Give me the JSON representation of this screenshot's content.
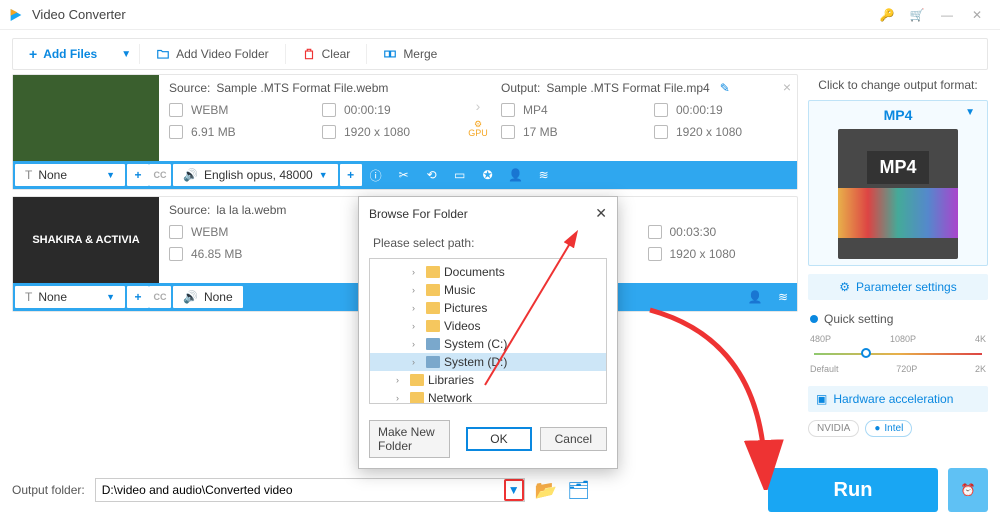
{
  "app": {
    "title": "Video Converter"
  },
  "toolbar": {
    "add_files": "Add Files",
    "add_folder": "Add Video Folder",
    "clear": "Clear",
    "merge": "Merge"
  },
  "items": [
    {
      "source_label": "Source:",
      "source_name": "Sample .MTS Format File.webm",
      "output_label": "Output:",
      "output_name": "Sample .MTS Format File.mp4",
      "src_format": "WEBM",
      "src_dur": "00:00:19",
      "src_size": "6.91 MB",
      "src_res": "1920 x 1080",
      "out_format": "MP4",
      "out_dur": "00:00:19",
      "out_size": "17 MB",
      "out_res": "1920 x 1080",
      "gpu": "GPU",
      "track_sub": "None",
      "track_audio": "English opus, 48000"
    },
    {
      "source_label": "Source:",
      "source_name": "la la la.webm",
      "thumb_text": "SHAKIRA & ACTIVIA",
      "src_format": "WEBM",
      "src_dur": "00:03:30",
      "src_size": "46.85 MB",
      "src_res": "1920 x 1080",
      "out_format": "",
      "out_dur": "00:03:30",
      "out_size": "",
      "out_res": "1920 x 1080",
      "track_sub": "None",
      "track_audio": "None"
    }
  ],
  "right": {
    "click_label": "Click to change output format:",
    "format": "MP4",
    "preview_text": "MP4",
    "param_btn": "Parameter settings",
    "quick_title": "Quick setting",
    "ticks_top": [
      "480P",
      "1080P",
      "4K"
    ],
    "ticks_bot": [
      "Default",
      "720P",
      "2K"
    ],
    "hw_btn": "Hardware acceleration",
    "nvidia": "NVIDIA",
    "intel": "Intel"
  },
  "bottom": {
    "label": "Output folder:",
    "path": "D:\\video and audio\\Converted video",
    "run": "Run"
  },
  "dialog": {
    "title": "Browse For Folder",
    "subtitle": "Please select path:",
    "nodes": [
      {
        "label": "Documents",
        "indent": 2,
        "chev": "›",
        "type": "folder"
      },
      {
        "label": "Music",
        "indent": 2,
        "chev": "›",
        "type": "folder"
      },
      {
        "label": "Pictures",
        "indent": 2,
        "chev": "›",
        "type": "folder"
      },
      {
        "label": "Videos",
        "indent": 2,
        "chev": "›",
        "type": "folder"
      },
      {
        "label": "System (C:)",
        "indent": 2,
        "chev": "›",
        "type": "drive"
      },
      {
        "label": "System (D:)",
        "indent": 2,
        "chev": "›",
        "type": "drive",
        "selected": true
      },
      {
        "label": "Libraries",
        "indent": 1,
        "chev": "›",
        "type": "folder"
      },
      {
        "label": "Network",
        "indent": 1,
        "chev": "›",
        "type": "folder"
      }
    ],
    "make": "Make New Folder",
    "ok": "OK",
    "cancel": "Cancel"
  }
}
